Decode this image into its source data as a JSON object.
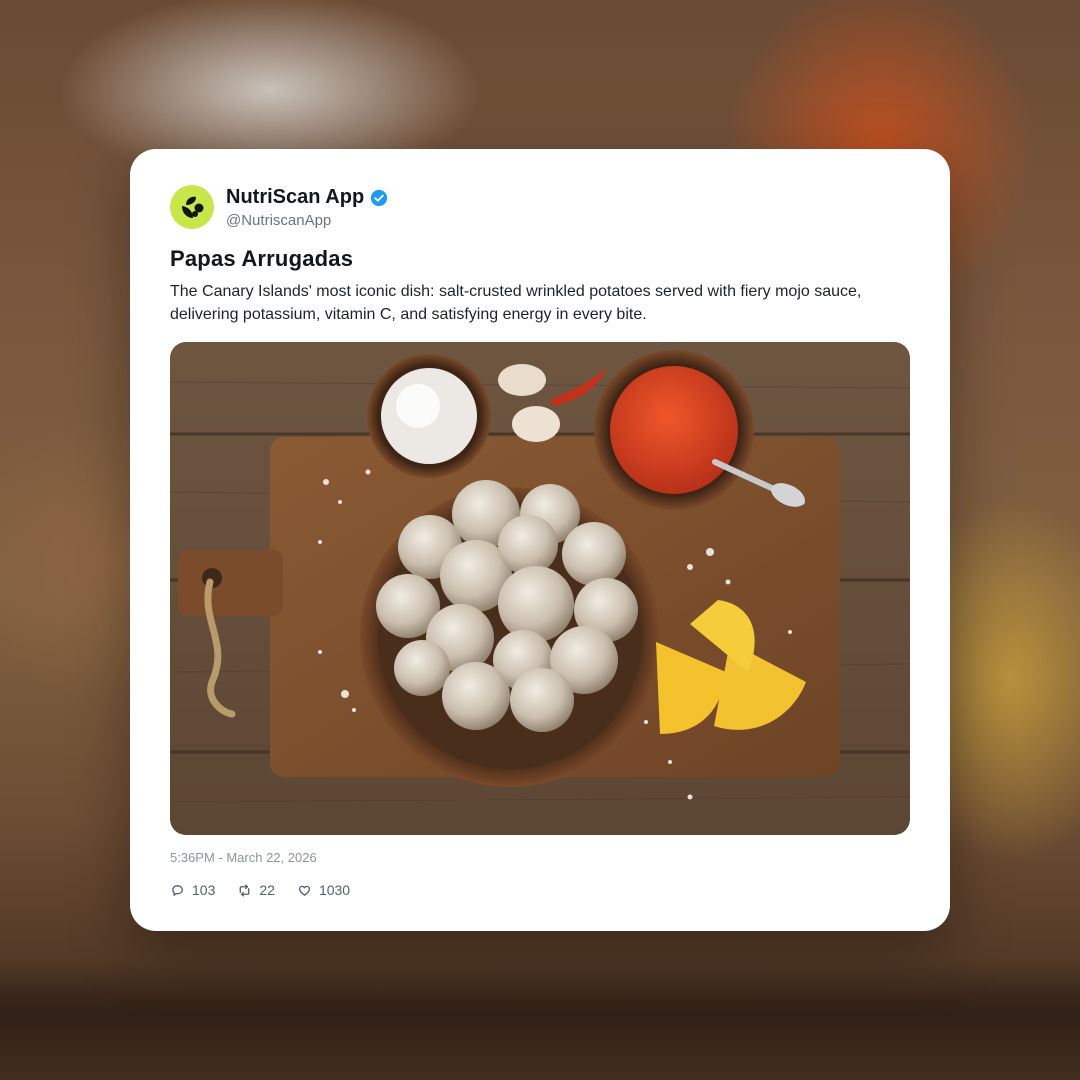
{
  "profile": {
    "display_name": "NutriScan App",
    "handle": "@NutriscanApp",
    "verified": true,
    "avatar_icon": "leaf-badge-icon",
    "brand_color": "#c8e64a",
    "verified_color": "#1d9bf0"
  },
  "post": {
    "title": "Papas Arrugadas",
    "body": "The Canary Islands' most iconic dish: salt-crusted wrinkled potatoes served with fiery mojo sauce, delivering potassium, vitamin C, and satisfying energy in every bite.",
    "image_icon": "food-photo",
    "timestamp": "5:36PM - March 22, 2026"
  },
  "stats": {
    "replies": "103",
    "reposts": "22",
    "likes": "1030"
  }
}
